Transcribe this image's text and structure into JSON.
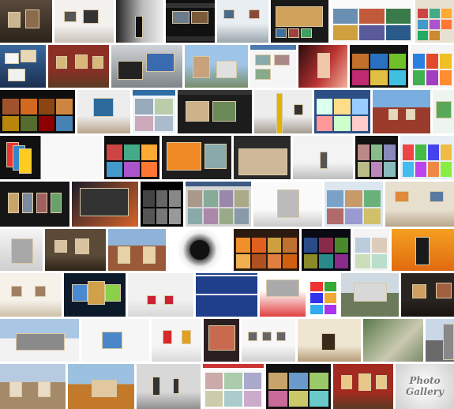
{
  "rows": [
    {
      "tiles": [
        {
          "theme": "dark-gallery-room",
          "w": 66
        },
        {
          "theme": "white-gallery",
          "w": 75
        },
        {
          "theme": "bw-figure-window",
          "w": 60
        },
        {
          "theme": "black-web-ui",
          "w": 62
        },
        {
          "theme": "gallery-hall-bright",
          "w": 65
        },
        {
          "theme": "dark-slideshow-ui",
          "w": 73
        },
        {
          "theme": "thumb-grid-white",
          "w": 104
        },
        {
          "theme": "colorful-collage",
          "w": 61
        }
      ]
    },
    {
      "tiles": [
        {
          "theme": "floating-photos",
          "w": 58
        },
        {
          "theme": "museum-red-hall",
          "w": 77
        },
        {
          "theme": "grey-3d-ui",
          "w": 90
        },
        {
          "theme": "street-photo",
          "w": 80
        },
        {
          "theme": "white-ui-list",
          "w": 58
        },
        {
          "theme": "portrait-red",
          "w": 62
        },
        {
          "theme": "dark-media-grid",
          "w": 74
        },
        {
          "theme": "colorful-dots",
          "w": 69
        }
      ]
    },
    {
      "tiles": [
        {
          "theme": "dark-filmstrip",
          "w": 95
        },
        {
          "theme": "wordpress-gallery",
          "w": 67
        },
        {
          "theme": "blue-ui-panel",
          "w": 54
        },
        {
          "theme": "black-lightbox",
          "w": 94
        },
        {
          "theme": "yellow-column-gallery",
          "w": 73
        },
        {
          "theme": "blue-thumb-grid",
          "w": 71
        },
        {
          "theme": "brick-building",
          "w": 73
        },
        {
          "theme": "green-card",
          "w": 27
        }
      ]
    },
    {
      "tiles": [
        {
          "theme": "photo-galleries-fan",
          "w": 129
        },
        {
          "theme": "slim-web-gallery",
          "w": 70
        },
        {
          "theme": "orange-media-box",
          "w": 88
        },
        {
          "theme": "global-gallery",
          "w": 72
        },
        {
          "theme": "white-room-sculpture",
          "w": 76
        },
        {
          "theme": "dark-photo-grid",
          "w": 54
        },
        {
          "theme": "icon-palette",
          "w": 72
        }
      ]
    },
    {
      "tiles": [
        {
          "theme": "dark-frames-row",
          "w": 88
        },
        {
          "theme": "orange-desktop",
          "w": 84
        },
        {
          "theme": "black-thumb-wall",
          "w": 54
        },
        {
          "theme": "grey-thumb-panel",
          "w": 83
        },
        {
          "theme": "white-corridor",
          "w": 87
        },
        {
          "theme": "landscape-grid",
          "w": 74
        },
        {
          "theme": "beige-room-painting",
          "w": 88
        }
      ]
    },
    {
      "tiles": [
        {
          "theme": "white-spiral",
          "w": 54
        },
        {
          "theme": "warm-gallery-room",
          "w": 77
        },
        {
          "theme": "ornate-museum",
          "w": 73
        },
        {
          "theme": "camera-lens",
          "w": 80
        },
        {
          "theme": "orange-app-grid",
          "w": 83
        },
        {
          "theme": "night-mosaic",
          "w": 62
        },
        {
          "theme": "white-thumbs",
          "w": 46
        },
        {
          "theme": "dancer-orange",
          "w": 78
        }
      ]
    },
    {
      "tiles": [
        {
          "theme": "bright-hall",
          "w": 78
        },
        {
          "theme": "carousel-dark",
          "w": 78
        },
        {
          "theme": "white-benches",
          "w": 83
        },
        {
          "theme": "blue-text-slide",
          "w": 78
        },
        {
          "theme": "red-bed-ad",
          "w": 58
        },
        {
          "theme": "colorful-grid-small",
          "w": 39
        },
        {
          "theme": "modern-building",
          "w": 73
        },
        {
          "theme": "dark-art-room",
          "w": 77
        }
      ]
    },
    {
      "tiles": [
        {
          "theme": "snow-museum",
          "w": 100
        },
        {
          "theme": "white-ui-photo",
          "w": 86
        },
        {
          "theme": "pedestal-red",
          "w": 63
        },
        {
          "theme": "dark-web-box",
          "w": 45
        },
        {
          "theme": "white-wall-frames",
          "w": 68
        },
        {
          "theme": "cream-hall",
          "w": 80
        },
        {
          "theme": "aerial-roof",
          "w": 76
        },
        {
          "theme": "city-tower",
          "w": 57
        }
      ]
    },
    {
      "tiles": [
        {
          "theme": "old-building",
          "w": 83
        },
        {
          "theme": "autumn-tree-house",
          "w": 84
        },
        {
          "theme": "grey-corridor",
          "w": 81
        },
        {
          "theme": "white-ui-grid",
          "w": 77
        },
        {
          "theme": "black-thumb-box",
          "w": 82
        },
        {
          "theme": "red-gallery-wall",
          "w": 76
        },
        {
          "theme": "photo-gallery-logo",
          "w": 77,
          "label": "Photo\nGallery"
        }
      ]
    }
  ]
}
